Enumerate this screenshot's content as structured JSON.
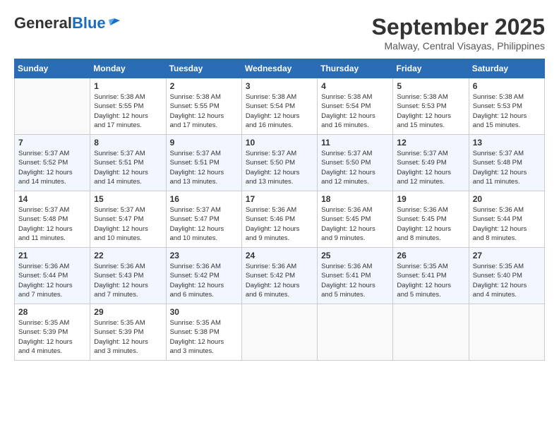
{
  "header": {
    "logo_general": "General",
    "logo_blue": "Blue",
    "month_title": "September 2025",
    "location": "Malway, Central Visayas, Philippines"
  },
  "days_of_week": [
    "Sunday",
    "Monday",
    "Tuesday",
    "Wednesday",
    "Thursday",
    "Friday",
    "Saturday"
  ],
  "weeks": [
    [
      {
        "day": "",
        "info": ""
      },
      {
        "day": "1",
        "info": "Sunrise: 5:38 AM\nSunset: 5:55 PM\nDaylight: 12 hours\nand 17 minutes."
      },
      {
        "day": "2",
        "info": "Sunrise: 5:38 AM\nSunset: 5:55 PM\nDaylight: 12 hours\nand 17 minutes."
      },
      {
        "day": "3",
        "info": "Sunrise: 5:38 AM\nSunset: 5:54 PM\nDaylight: 12 hours\nand 16 minutes."
      },
      {
        "day": "4",
        "info": "Sunrise: 5:38 AM\nSunset: 5:54 PM\nDaylight: 12 hours\nand 16 minutes."
      },
      {
        "day": "5",
        "info": "Sunrise: 5:38 AM\nSunset: 5:53 PM\nDaylight: 12 hours\nand 15 minutes."
      },
      {
        "day": "6",
        "info": "Sunrise: 5:38 AM\nSunset: 5:53 PM\nDaylight: 12 hours\nand 15 minutes."
      }
    ],
    [
      {
        "day": "7",
        "info": "Sunrise: 5:37 AM\nSunset: 5:52 PM\nDaylight: 12 hours\nand 14 minutes."
      },
      {
        "day": "8",
        "info": "Sunrise: 5:37 AM\nSunset: 5:51 PM\nDaylight: 12 hours\nand 14 minutes."
      },
      {
        "day": "9",
        "info": "Sunrise: 5:37 AM\nSunset: 5:51 PM\nDaylight: 12 hours\nand 13 minutes."
      },
      {
        "day": "10",
        "info": "Sunrise: 5:37 AM\nSunset: 5:50 PM\nDaylight: 12 hours\nand 13 minutes."
      },
      {
        "day": "11",
        "info": "Sunrise: 5:37 AM\nSunset: 5:50 PM\nDaylight: 12 hours\nand 12 minutes."
      },
      {
        "day": "12",
        "info": "Sunrise: 5:37 AM\nSunset: 5:49 PM\nDaylight: 12 hours\nand 12 minutes."
      },
      {
        "day": "13",
        "info": "Sunrise: 5:37 AM\nSunset: 5:48 PM\nDaylight: 12 hours\nand 11 minutes."
      }
    ],
    [
      {
        "day": "14",
        "info": "Sunrise: 5:37 AM\nSunset: 5:48 PM\nDaylight: 12 hours\nand 11 minutes."
      },
      {
        "day": "15",
        "info": "Sunrise: 5:37 AM\nSunset: 5:47 PM\nDaylight: 12 hours\nand 10 minutes."
      },
      {
        "day": "16",
        "info": "Sunrise: 5:37 AM\nSunset: 5:47 PM\nDaylight: 12 hours\nand 10 minutes."
      },
      {
        "day": "17",
        "info": "Sunrise: 5:36 AM\nSunset: 5:46 PM\nDaylight: 12 hours\nand 9 minutes."
      },
      {
        "day": "18",
        "info": "Sunrise: 5:36 AM\nSunset: 5:45 PM\nDaylight: 12 hours\nand 9 minutes."
      },
      {
        "day": "19",
        "info": "Sunrise: 5:36 AM\nSunset: 5:45 PM\nDaylight: 12 hours\nand 8 minutes."
      },
      {
        "day": "20",
        "info": "Sunrise: 5:36 AM\nSunset: 5:44 PM\nDaylight: 12 hours\nand 8 minutes."
      }
    ],
    [
      {
        "day": "21",
        "info": "Sunrise: 5:36 AM\nSunset: 5:44 PM\nDaylight: 12 hours\nand 7 minutes."
      },
      {
        "day": "22",
        "info": "Sunrise: 5:36 AM\nSunset: 5:43 PM\nDaylight: 12 hours\nand 7 minutes."
      },
      {
        "day": "23",
        "info": "Sunrise: 5:36 AM\nSunset: 5:42 PM\nDaylight: 12 hours\nand 6 minutes."
      },
      {
        "day": "24",
        "info": "Sunrise: 5:36 AM\nSunset: 5:42 PM\nDaylight: 12 hours\nand 6 minutes."
      },
      {
        "day": "25",
        "info": "Sunrise: 5:36 AM\nSunset: 5:41 PM\nDaylight: 12 hours\nand 5 minutes."
      },
      {
        "day": "26",
        "info": "Sunrise: 5:35 AM\nSunset: 5:41 PM\nDaylight: 12 hours\nand 5 minutes."
      },
      {
        "day": "27",
        "info": "Sunrise: 5:35 AM\nSunset: 5:40 PM\nDaylight: 12 hours\nand 4 minutes."
      }
    ],
    [
      {
        "day": "28",
        "info": "Sunrise: 5:35 AM\nSunset: 5:39 PM\nDaylight: 12 hours\nand 4 minutes."
      },
      {
        "day": "29",
        "info": "Sunrise: 5:35 AM\nSunset: 5:39 PM\nDaylight: 12 hours\nand 3 minutes."
      },
      {
        "day": "30",
        "info": "Sunrise: 5:35 AM\nSunset: 5:38 PM\nDaylight: 12 hours\nand 3 minutes."
      },
      {
        "day": "",
        "info": ""
      },
      {
        "day": "",
        "info": ""
      },
      {
        "day": "",
        "info": ""
      },
      {
        "day": "",
        "info": ""
      }
    ]
  ]
}
